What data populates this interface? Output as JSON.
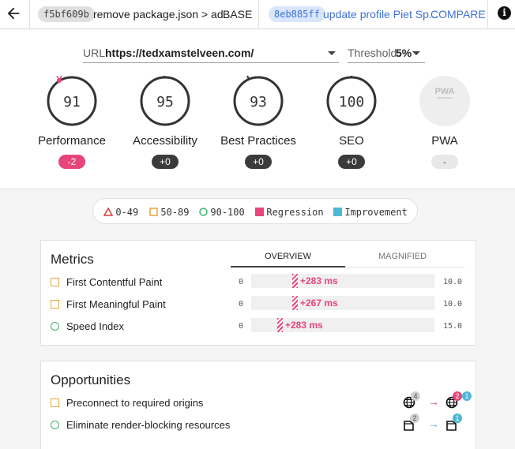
{
  "topbar": {
    "base": {
      "hash": "f5bf609b",
      "message": "remove package.json > ad...",
      "tag": "BASE"
    },
    "compare": {
      "hash": "8eb885ff",
      "message": "update profile Piet Sp...",
      "tag": "COMPARE"
    },
    "info_glyph": "i"
  },
  "selectors": {
    "url_label": "URL",
    "url_value": "https://tedxamstelveen.com/",
    "threshold_label": "Threshold",
    "threshold_value": "5%"
  },
  "gauges": [
    {
      "label": "Performance",
      "score": "91",
      "delta": "-2",
      "status": "negative"
    },
    {
      "label": "Accessibility",
      "score": "95",
      "delta": "+0",
      "status": "neutral"
    },
    {
      "label": "Best Practices",
      "score": "93",
      "delta": "+0",
      "status": "neutral"
    },
    {
      "label": "SEO",
      "score": "100",
      "delta": "+0",
      "status": "neutral"
    },
    {
      "label": "PWA",
      "score": "PWA",
      "delta": "-",
      "status": "na"
    }
  ],
  "legend": [
    {
      "icon": "triangle-red-icon",
      "label": "0-49"
    },
    {
      "icon": "square-orange-icon",
      "label": "50-89"
    },
    {
      "icon": "circle-green-icon",
      "label": "90-100"
    },
    {
      "icon": "regression-swatch-icon",
      "label": "Regression"
    },
    {
      "icon": "improvement-swatch-icon",
      "label": "Improvement"
    }
  ],
  "metrics": {
    "title": "Metrics",
    "tabs": {
      "overview": "OVERVIEW",
      "magnified": "MAGNIFIED"
    },
    "rows": [
      {
        "name": "First Contentful Paint",
        "min": "0",
        "max": "10.0",
        "delta": "+283 ms",
        "indicator": "square-orange"
      },
      {
        "name": "First Meaningful Paint",
        "min": "0",
        "max": "10.0",
        "delta": "+267 ms",
        "indicator": "square-orange"
      },
      {
        "name": "Speed Index",
        "min": "0",
        "max": "15.0",
        "delta": "+283 ms",
        "indicator": "circle-green"
      }
    ]
  },
  "opportunities": {
    "title": "Opportunities",
    "rows": [
      {
        "name": "Preconnect to required origins",
        "indicator": "square-orange",
        "base_count": "4",
        "compare_badges": [
          "2",
          "1"
        ]
      },
      {
        "name": "Eliminate render-blocking resources",
        "indicator": "circle-green",
        "base_count": "2",
        "compare_badges": [
          "1"
        ]
      }
    ]
  },
  "colors": {
    "regression": "#e8457a",
    "improvement": "#4fb6d6",
    "average": "#e8a33b",
    "pass": "#3fb36a",
    "fail": "#e53935",
    "link": "#3f71d8"
  }
}
